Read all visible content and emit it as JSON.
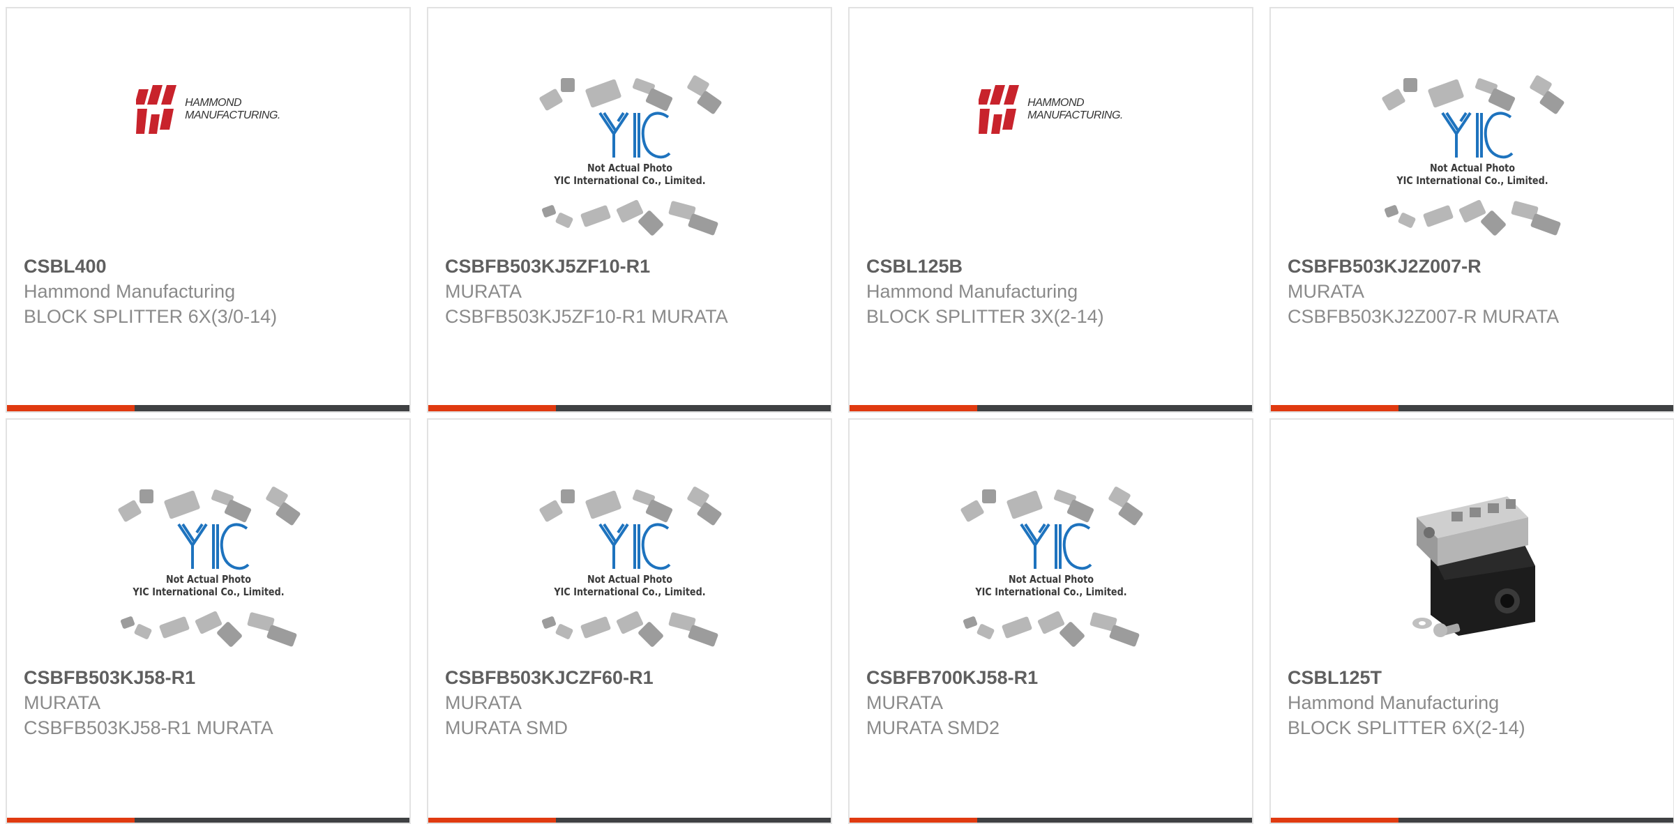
{
  "colors": {
    "accent": "#e03a10",
    "bar": "#3f4143",
    "title": "#5f5f5f",
    "text": "#8a8a8a",
    "yic_blue": "#1e73be"
  },
  "placeholder": {
    "logo_text": "YIC",
    "caption_line1": "Not Actual Photo",
    "caption_line2": "YIC International Co., Limited."
  },
  "hammond_logo": {
    "line1": "HAMMOND",
    "line2": "MANUFACTURING."
  },
  "products": [
    {
      "part_number": "CSBL400",
      "manufacturer": "Hammond Manufacturing",
      "description": "BLOCK SPLITTER 6X(3/0-14)",
      "image": "hammond-logo"
    },
    {
      "part_number": "CSBFB503KJ5ZF10-R1",
      "manufacturer": "MURATA",
      "description": "CSBFB503KJ5ZF10-R1 MURATA",
      "image": "yic-placeholder"
    },
    {
      "part_number": "CSBL125B",
      "manufacturer": "Hammond Manufacturing",
      "description": "BLOCK SPLITTER 3X(2-14)",
      "image": "hammond-logo"
    },
    {
      "part_number": "CSBFB503KJ2Z007-R",
      "manufacturer": "MURATA",
      "description": "CSBFB503KJ2Z007-R MURATA",
      "image": "yic-placeholder"
    },
    {
      "part_number": "CSBFB503KJ58-R1",
      "manufacturer": "MURATA",
      "description": "CSBFB503KJ58-R1 MURATA",
      "image": "yic-placeholder"
    },
    {
      "part_number": "CSBFB503KJCZF60-R1",
      "manufacturer": "MURATA",
      "description": "MURATA SMD",
      "image": "yic-placeholder"
    },
    {
      "part_number": "CSBFB700KJ58-R1",
      "manufacturer": "MURATA",
      "description": "MURATA SMD2",
      "image": "yic-placeholder"
    },
    {
      "part_number": "CSBL125T",
      "manufacturer": "Hammond Manufacturing",
      "description": "BLOCK SPLITTER 6X(2-14)",
      "image": "splitter-block-photo"
    }
  ]
}
